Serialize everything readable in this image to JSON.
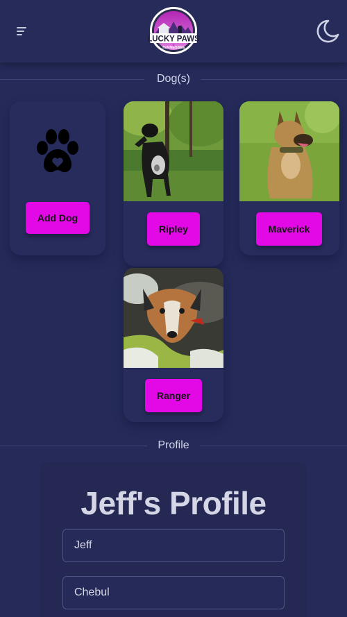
{
  "header": {
    "logo_text": "LUCKY PAWS",
    "logo_subtext": "TENNESSEE",
    "menu_icon": "menu-icon",
    "theme_icon": "moon-icon"
  },
  "dogs_section": {
    "title": "Dog(s)",
    "add_dog_label": "Add Dog",
    "add_icon": "paw-icon",
    "dogs": [
      {
        "name": "Ripley"
      },
      {
        "name": "Maverick"
      },
      {
        "name": "Ranger"
      }
    ]
  },
  "profile_section": {
    "title": "Profile",
    "heading": "Jeff's Profile",
    "first_name_value": "Jeff",
    "last_name_value": "Chebul"
  },
  "colors": {
    "background": "#252a59",
    "accent": "#e209e6"
  }
}
